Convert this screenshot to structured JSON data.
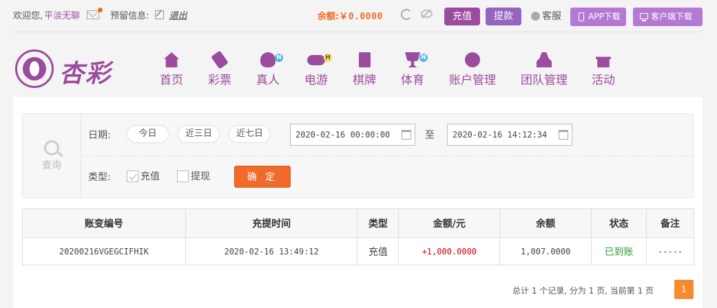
{
  "topbar": {
    "welcome": "欢迎您,",
    "username": "平淡无聊",
    "reserved_label": "预留信息:",
    "logout": "退出",
    "balance_label": "余额:",
    "balance_value": "￥0.0000",
    "recharge": "充值",
    "withdraw": "提款",
    "customer_service": "客服",
    "app_download": "APP下载",
    "client_download": "客户端下载"
  },
  "brand": {
    "logo_text": "杏彩"
  },
  "nav": [
    {
      "label": "首页",
      "icon": "home-icon",
      "badge": ""
    },
    {
      "label": "彩票",
      "icon": "ticket-icon",
      "badge": ""
    },
    {
      "label": "真人",
      "icon": "live-dealer-icon",
      "badge": "N"
    },
    {
      "label": "电游",
      "icon": "gamepad-icon",
      "badge": "H"
    },
    {
      "label": "棋牌",
      "icon": "cards-icon",
      "badge": ""
    },
    {
      "label": "体育",
      "icon": "trophy-icon",
      "badge": "N"
    },
    {
      "label": "账户管理",
      "icon": "yen-coin-icon",
      "badge": ""
    },
    {
      "label": "团队管理",
      "icon": "team-icon",
      "badge": ""
    },
    {
      "label": "活动",
      "icon": "gift-icon",
      "badge": ""
    }
  ],
  "filter": {
    "query_label": "查询",
    "date_label": "日期:",
    "quick": [
      "今日",
      "近三日",
      "近七日"
    ],
    "start_date": "2020-02-16 00:00:00",
    "to_label": "至",
    "end_date": "2020-02-16 14:12:34",
    "type_label": "类型:",
    "type_recharge": "充值",
    "type_recharge_checked": true,
    "type_withdraw": "提现",
    "type_withdraw_checked": false,
    "confirm": "确 定"
  },
  "table": {
    "headers": [
      "账变编号",
      "充提时间",
      "类型",
      "金额/元",
      "余额",
      "状态",
      "备注"
    ],
    "rows": [
      {
        "id": "20200216VGEGCIFHIK",
        "time": "2020-02-16 13:49:12",
        "type": "充值",
        "amount": "+1,000.0000",
        "balance": "1,007.0000",
        "status": "已到账",
        "note": "-----"
      }
    ]
  },
  "pager": {
    "summary": "总计 1 个记录, 分为 1 页, 当前第 1 页",
    "current_page": "1"
  },
  "colors": {
    "brand": "#9b4c9e",
    "accent": "#f26c1f",
    "success": "#2f9b2f"
  }
}
